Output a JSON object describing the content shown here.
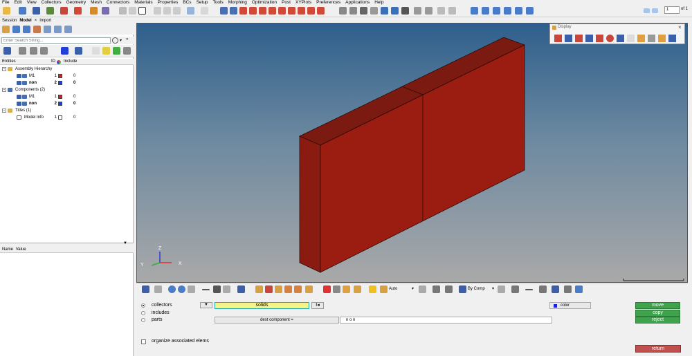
{
  "menu": [
    "File",
    "Edit",
    "View",
    "Collectors",
    "Geometry",
    "Mesh",
    "Connectors",
    "Materials",
    "Properties",
    "BCs",
    "Setup",
    "Tools",
    "Morphing",
    "Optimization",
    "Post",
    "XYPlots",
    "Preferences",
    "Applications",
    "Help"
  ],
  "page": {
    "current": "1",
    "of_label": "of 1"
  },
  "tabs": [
    "Session",
    "Model",
    "Import"
  ],
  "search": {
    "placeholder": "Enter Search String..."
  },
  "tree": {
    "headers": {
      "entities": "Entities",
      "id": "ID",
      "include": "Include"
    },
    "rows": [
      {
        "label": "Assembly Hierarchy",
        "level": 0,
        "id": "",
        "include": "",
        "bold": false
      },
      {
        "label": "M1",
        "level": 1,
        "id": "1",
        "include": "0",
        "color": "#c0282a",
        "bold": false
      },
      {
        "label": "non",
        "level": 1,
        "id": "2",
        "include": "0",
        "color": "#1f3fd8",
        "bold": true
      },
      {
        "label": "Components (2)",
        "level": 0,
        "id": "",
        "include": "",
        "bold": false
      },
      {
        "label": "M1",
        "level": 1,
        "id": "1",
        "include": "0",
        "color": "#c0282a",
        "bold": false
      },
      {
        "label": "non",
        "level": 1,
        "id": "2",
        "include": "0",
        "color": "#1f3fd8",
        "bold": true
      },
      {
        "label": "Titles (1)",
        "level": 0,
        "id": "",
        "include": "",
        "bold": false
      },
      {
        "label": "Model Info",
        "level": 1,
        "id": "1",
        "include": "0",
        "color": "#ffffff",
        "bold": false
      }
    ]
  },
  "properties": {
    "name_header": "Name",
    "value_header": "Value"
  },
  "display_panel": {
    "title": "Display"
  },
  "triad": {
    "x": "X",
    "y": "Y",
    "z": "Z"
  },
  "viewtools": {
    "auto_label": "Auto",
    "bycomp_label": "By Comp"
  },
  "bottom": {
    "radio_collectors": "collectors",
    "radio_includes": "includes",
    "radio_parts": "parts",
    "solids_label": "solids",
    "dest_component_label": "dest component =",
    "dest_value": "n o n",
    "color_label": "color",
    "move_label": "move",
    "copy_label": "copy",
    "reject_label": "reject",
    "return_label": "return",
    "organize_label": "organize associated elems"
  },
  "colors": {
    "solid": "#9b1d12",
    "accent_green": "#3fa34d",
    "return_red": "#c0504d",
    "solids_bg": "#f4f48a"
  }
}
